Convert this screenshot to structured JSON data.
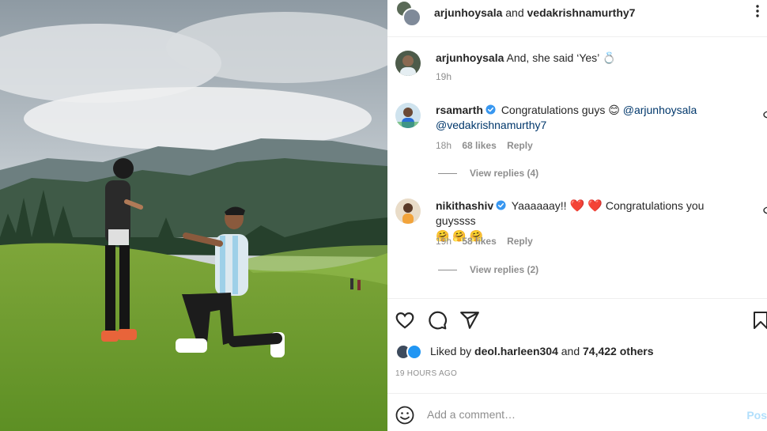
{
  "header": {
    "user1": "arjunhoysala",
    "and_text": "and",
    "user2": "vedakrishnamurthy7"
  },
  "caption": {
    "username": "arjunhoysala",
    "text": "And, she said ‘Yes’",
    "emoji": "💍",
    "time": "19h"
  },
  "comments": [
    {
      "username": "rsamarth",
      "verified": true,
      "text": "Congratulations guys",
      "emoji": "😊",
      "mention1": "@arjunhoysala",
      "mention2": "@vedakrishnamurthy7",
      "time": "18h",
      "likes": "68 likes",
      "reply": "Reply",
      "view_replies": "View replies (4)"
    },
    {
      "username": "nikithashiv",
      "verified": true,
      "text": "Yaaaaaay!!",
      "hearts": "❤️ ❤️",
      "text2": "Congratulations you guyssss",
      "emojis": "🤗 🤗 🤗",
      "time": "19h",
      "likes": "58 likes",
      "reply": "Reply",
      "view_replies": "View replies (2)"
    }
  ],
  "likes": {
    "liked_by": "Liked by",
    "user": "deol.harleen304",
    "and": "and",
    "count": "74,422 others"
  },
  "time_ago": "19 HOURS AGO",
  "add_comment": {
    "placeholder": "Add a comment…",
    "post_label": "Pos"
  },
  "colors": {
    "verified": "#3897f0",
    "link": "#00376b",
    "muted": "#8e8e8e",
    "post_disabled": "#b2dffc"
  },
  "icons": [
    "more-icon",
    "heart-icon",
    "comment-icon",
    "share-icon",
    "bookmark-icon",
    "smile-icon",
    "verified-icon"
  ]
}
